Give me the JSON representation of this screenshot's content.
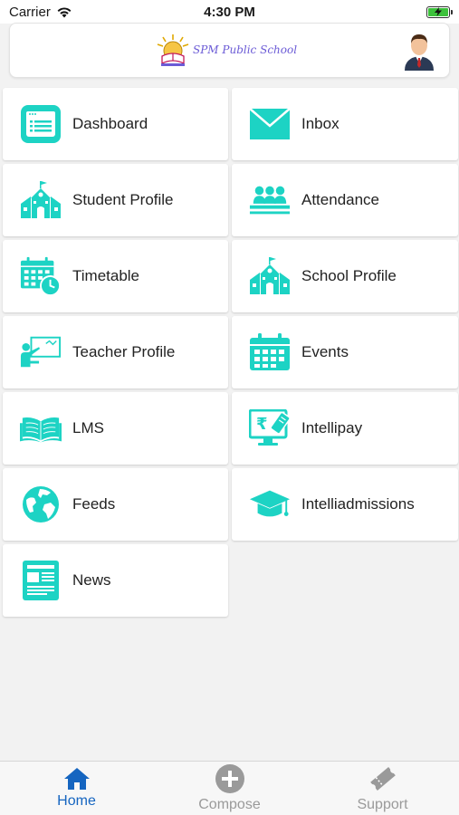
{
  "status_bar": {
    "carrier": "Carrier",
    "time": "4:30 PM"
  },
  "header": {
    "school_name": "SPM Public School"
  },
  "tiles": [
    {
      "label": "Dashboard",
      "icon": "dashboard-icon"
    },
    {
      "label": "Inbox",
      "icon": "mail-icon"
    },
    {
      "label": "Student Profile",
      "icon": "school-building-icon"
    },
    {
      "label": "Attendance",
      "icon": "group-icon"
    },
    {
      "label": "Timetable",
      "icon": "calendar-clock-icon"
    },
    {
      "label": "School Profile",
      "icon": "school-building-icon"
    },
    {
      "label": "Teacher Profile",
      "icon": "teacher-board-icon"
    },
    {
      "label": "Events",
      "icon": "calendar-icon"
    },
    {
      "label": "LMS",
      "icon": "open-book-icon"
    },
    {
      "label": "Intellipay",
      "icon": "rupee-monitor-icon"
    },
    {
      "label": "Feeds",
      "icon": "globe-icon"
    },
    {
      "label": "Intelliadmissions",
      "icon": "graduation-cap-icon"
    },
    {
      "label": "News",
      "icon": "newspaper-icon"
    }
  ],
  "tabbar": {
    "home": "Home",
    "compose": "Compose",
    "support": "Support"
  },
  "colors": {
    "accent": "#1dd3c4",
    "active_tab": "#1565c0",
    "inactive_tab": "#9a9a9a"
  }
}
